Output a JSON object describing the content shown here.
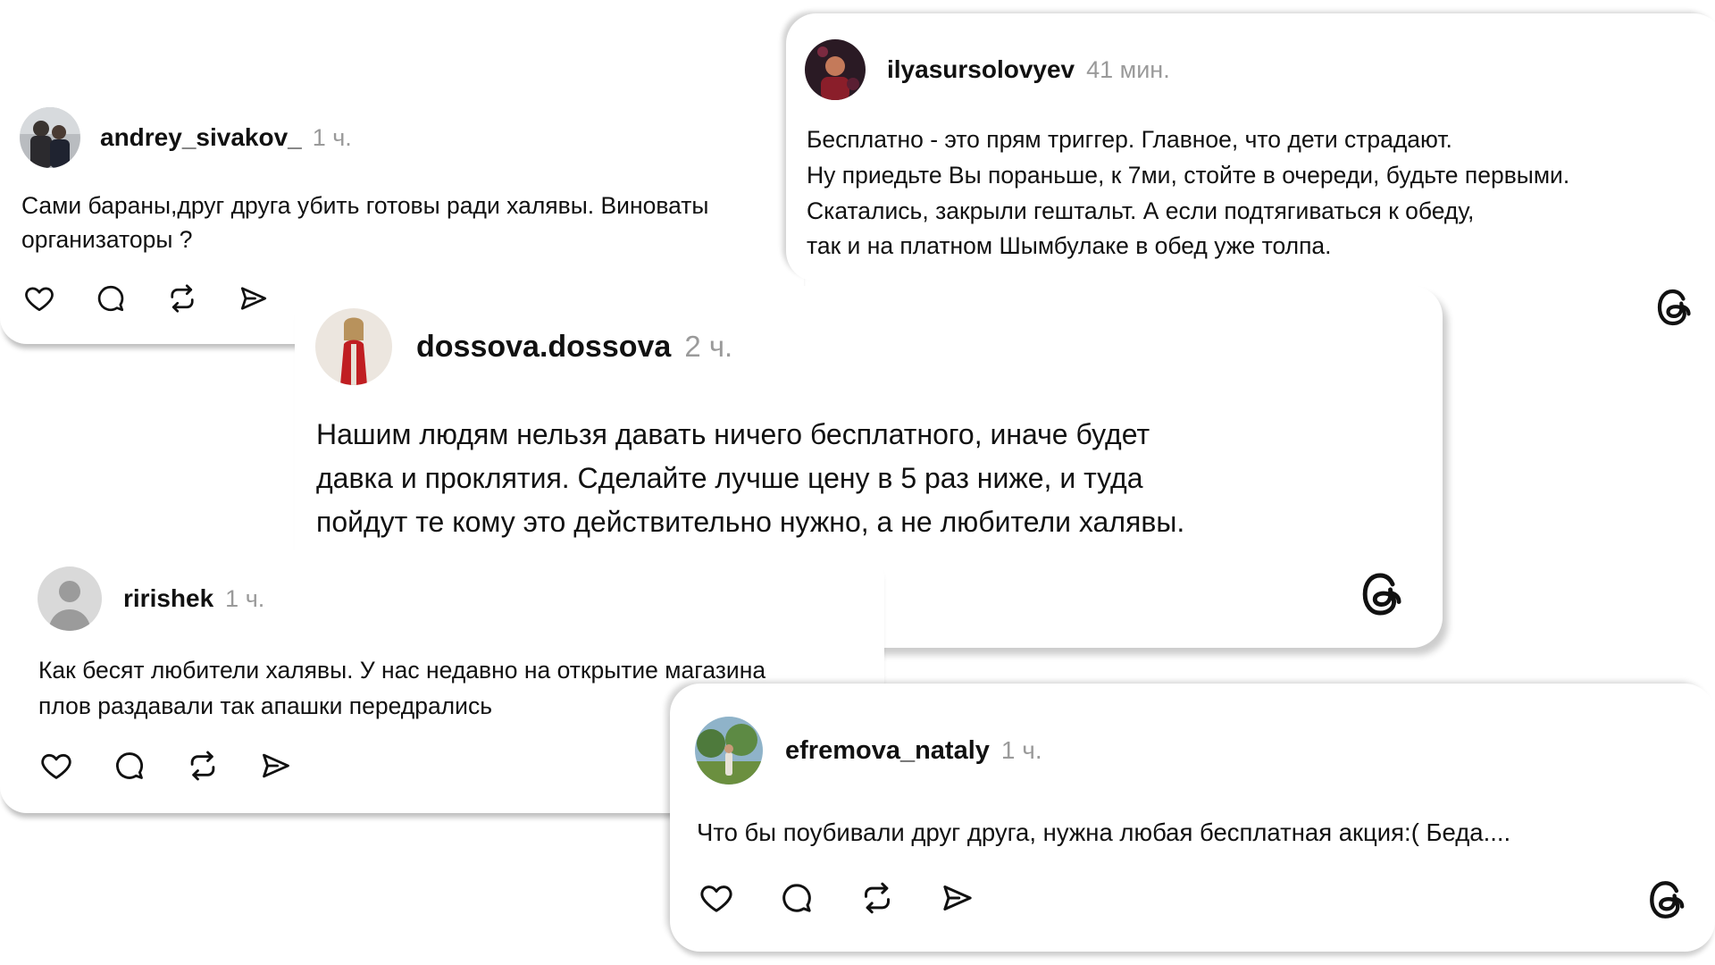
{
  "posts": [
    {
      "username": "andrey_sivakov_",
      "time": "1 ч.",
      "avatar": "profile-photo",
      "text_lines": [
        "Сами бараны,друг друга убить готовы ради халявы. Виноваты",
        "организаторы ?"
      ],
      "actions": [
        "heart-icon",
        "comment-icon",
        "repost-icon",
        "share-icon"
      ]
    },
    {
      "username": "ilyasursolovyev",
      "time": "41 мин.",
      "avatar": "profile-photo",
      "text_lines": [
        "Бесплатно - это прям триггер. Главное, что дети страдают.",
        "Ну приедьте Вы пораньше, к 7ми, стойте в очереди, будьте первыми.",
        "Скатались, закрыли гештальт. А если подтягиваться к обеду,",
        "так и на платном Шымбулаке в обед уже толпа."
      ]
    },
    {
      "username": "dossova.dossova",
      "time": "2 ч.",
      "avatar": "profile-photo",
      "text_lines": [
        "Нашим людям нельзя давать ничего бесплатного, иначе будет",
        "давка и проклятия. Сделайте лучше цену в 5 раз ниже, и туда",
        "пойдут те кому это действительно нужно, а не любители халявы."
      ]
    },
    {
      "username": "ririshek",
      "time": "1 ч.",
      "avatar": "default-avatar",
      "text_lines": [
        "Как бесят любители халявы. У нас недавно на открытие магазина",
        "плов раздавали так апашки передрались"
      ],
      "actions": [
        "heart-icon",
        "comment-icon",
        "repost-icon",
        "share-icon"
      ]
    },
    {
      "username": "efremova_nataly",
      "time": "1 ч.",
      "avatar": "profile-photo",
      "text_lines": [
        "Что бы поубивали друг друга, нужна любая бесплатная акция:( Беда...."
      ],
      "actions": [
        "heart-icon",
        "comment-icon",
        "repost-icon",
        "share-icon"
      ]
    }
  ],
  "colors": {
    "text": "#111111",
    "timestamp": "#9a9a9a",
    "card": "#ffffff"
  },
  "brand_icon": "threads-logo-icon"
}
